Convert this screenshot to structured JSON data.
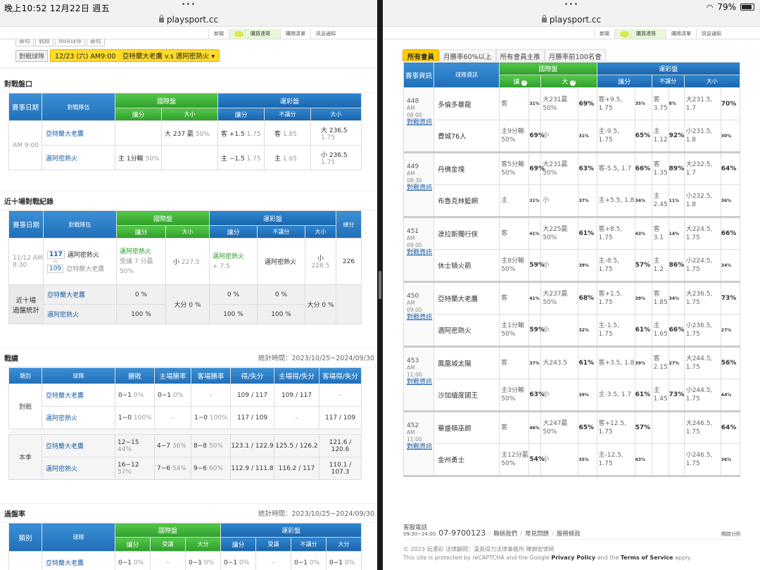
{
  "status_left": {
    "time": "晚上10:52",
    "date": "12月22日 週五"
  },
  "status_right": {
    "battery": "79%"
  },
  "url": "playsport.cc",
  "site_menu": [
    "新聞",
    "購買達哥",
    "購牌清單",
    "訊息通知"
  ],
  "site_menu_r": [
    "新聞",
    "購買達哥",
    "購牌清單",
    "訊息通知"
  ],
  "top_tabs": [
    "賽程",
    "戰績",
    "NBA球隊",
    "賽程"
  ],
  "match_select_label": "對戰球隊",
  "match_select_value": "12/23 (六) AM9:00　亞特蘭大老鷹 v.s 邁阿密熱火",
  "odds": {
    "title": "對戰盤口",
    "head": {
      "date": "賽事日期",
      "team": "對戰隊伍",
      "intl": "國際盤",
      "sport": "運彩盤",
      "spread": "讓分",
      "ou": "大小",
      "nospread": "不讓分"
    },
    "date": "AM 9:00",
    "teams": [
      "亞特蘭大老鷹",
      "邁阿密熱火"
    ],
    "r1": {
      "ou": "大 237 贏",
      "ou_p": "50%",
      "s_sp": "客 +1.5",
      "s_sp_o": "1.75",
      "s_ns": "客",
      "s_ns_o": "1.85",
      "s_ou": "大 236.5",
      "s_ou_o": "1.75"
    },
    "r2": {
      "sp": "主 1分輸",
      "sp_p": "50%",
      "s_sp": "主 −1.5",
      "s_sp_o": "1.75",
      "s_ns": "主",
      "s_ns_o": "1.65",
      "s_ou": "小 236.5",
      "s_ou_o": "1.75"
    }
  },
  "recent": {
    "title": "近十場對戰紀錄",
    "total": "總分",
    "date": "11/12 AM 8:30",
    "score_top": "117",
    "vs": "vs",
    "score_bot": "109",
    "team_top": "邁阿密熱火",
    "team_bot": "亞特蘭大老鷹",
    "sp_win": "邁阿密熱火",
    "sp_detail": "受讓 7 分贏",
    "sp_p": "50%",
    "ou": "小",
    "ou_v": "227.5",
    "s_sp_win": "邁阿密熱火",
    "s_sp_v": "+ 7.5",
    "s_ns": "邁阿密熱火",
    "s_ou": "小",
    "s_ou_v": "228.5",
    "total_v": "226",
    "stat_label": "近十場 過盤統計",
    "stat_teams": [
      "亞特蘭大老鷹",
      "邁阿密熱火"
    ],
    "stat_sp": [
      "0 %",
      "100 %"
    ],
    "stat_ou": "大分 0 %",
    "stat_s_sp": [
      "0 %",
      "100 %"
    ],
    "stat_s_ns": [
      "0 %",
      "100 %"
    ],
    "stat_s_ou": "大分 0 %"
  },
  "record": {
    "title": "戰績",
    "stat_period": "統計時間：2023/10/25~2024/09/30",
    "head": [
      "類別",
      "球隊",
      "勝敗",
      "主場勝率",
      "客場勝率",
      "得/失分",
      "主場得/失分",
      "客場得/失分"
    ],
    "g1": "對戰",
    "g2": "本季",
    "rows": [
      [
        "亞特蘭大老鷹",
        "0−1",
        "0%",
        "0−1",
        "0%",
        "–",
        "",
        "109 / 117",
        "109 / 117",
        "–"
      ],
      [
        "邁阿密熱火",
        "1−0",
        "100%",
        "–",
        "",
        "1−0",
        "100%",
        "117 / 109",
        "–",
        "117 / 109"
      ],
      [
        "亞特蘭大老鷹",
        "12−15",
        "44%",
        "4−7",
        "36%",
        "8−8",
        "50%",
        "123.1 / 122.9",
        "125.5 / 126.2",
        "121.6 / 120.6"
      ],
      [
        "邁阿密熱火",
        "16−12",
        "57%",
        "7−6",
        "54%",
        "9−6",
        "60%",
        "112.9 / 111.8",
        "116.2 / 117",
        "110.1 / 107.3"
      ]
    ]
  },
  "cover": {
    "title": "過盤率",
    "stat_period": "統計時間：2023/10/25~2024/09/30",
    "head": {
      "cat": "類別",
      "team": "球隊",
      "intl": "國際盤",
      "sport": "運彩盤",
      "spread": "讓分",
      "take": "受讓",
      "ou": "大分",
      "nospread": "不讓分"
    },
    "g1": "對戰",
    "row": [
      "亞特蘭大老鷹",
      "0−1",
      "0%",
      "–",
      "0−1",
      "0%",
      "0−1",
      "0%",
      "–",
      "0−1",
      "0%",
      "0−1",
      "0%"
    ]
  },
  "right": {
    "tabs": [
      "所有會員",
      "月勝率60%以上",
      "所有會員主推",
      "月勝率前100名會"
    ],
    "head": {
      "info": "賽事資訊",
      "team": "球隊資訊",
      "intl": "國際盤",
      "sport": "運彩盤",
      "spread": "讓",
      "ou": "大",
      "s_spread": "讓分",
      "s_ns": "不讓分",
      "s_ou": "大小"
    },
    "info_link": "對戰資訊",
    "games": [
      {
        "no": "448",
        "time": "AM 08:00",
        "a": {
          "team": "多倫多暴龍",
          "sp": "客",
          "sp_p": "31%",
          "ou": "大231贏 50%",
          "ou_p": "69%",
          "s_sp": "客+9.5, 1.75",
          "s_sp_p": "35%",
          "s_ns": "客 3.75",
          "s_ns_p": "8%",
          "s_ou": "大231.5, 1.7",
          "s_ou_p": "70%"
        },
        "b": {
          "team": "費城76人",
          "sp": "主9分輸 50%",
          "sp_p": "69%",
          "ou": "小",
          "ou_p": "31%",
          "s_sp": "主-9.5, 1.75",
          "s_sp_p": "65%",
          "s_ns": "主 1.12",
          "s_ns_p": "92%",
          "s_ou": "小231.5, 1.8",
          "s_ou_p": "30%"
        }
      },
      {
        "no": "449",
        "time": "AM 08:30",
        "a": {
          "team": "丹佛金塊",
          "sp": "客5分輸 50%",
          "sp_p": "69%",
          "ou": "大231贏 50%",
          "ou_p": "63%",
          "s_sp": "客-5.5, 1.7",
          "s_sp_p": "66%",
          "s_ns": "客 1.35",
          "s_ns_p": "89%",
          "s_ou": "大232.5, 1.7",
          "s_ou_p": "64%"
        },
        "b": {
          "team": "布魯克林籃網",
          "sp": "主",
          "sp_p": "31%",
          "ou": "小",
          "ou_p": "37%",
          "s_sp": "主+5.5, 1.8",
          "s_sp_p": "34%",
          "s_ns": "主 2.45",
          "s_ns_p": "11%",
          "s_ou": "小232.5, 1.8",
          "s_ou_p": "36%"
        }
      },
      {
        "no": "451",
        "time": "AM 09:00",
        "a": {
          "team": "達拉斯獨行俠",
          "sp": "客",
          "sp_p": "41%",
          "ou": "大225贏 50%",
          "ou_p": "61%",
          "s_sp": "客+8.5, 1.75",
          "s_sp_p": "43%",
          "s_ns": "客3.1",
          "s_ns_p": "14%",
          "s_ou": "大224.5, 1.75",
          "s_ou_p": "66%"
        },
        "b": {
          "team": "休士頓火箭",
          "sp": "主8分輸 50%",
          "sp_p": "59%",
          "ou": "小",
          "ou_p": "39%",
          "s_sp": "主-8.5, 1.75",
          "s_sp_p": "57%",
          "s_ns": "主1.2",
          "s_ns_p": "86%",
          "s_ou": "小224.5, 1.75",
          "s_ou_p": "34%"
        }
      },
      {
        "no": "450",
        "time": "AM 09:00",
        "a": {
          "team": "亞特蘭大老鷹",
          "sp": "客",
          "sp_p": "41%",
          "ou": "大237贏 50%",
          "ou_p": "68%",
          "s_sp": "客+1.5, 1.75",
          "s_sp_p": "39%",
          "s_ns": "客 1.85",
          "s_ns_p": "34%",
          "s_ou": "大236.5, 1.75",
          "s_ou_p": "73%"
        },
        "b": {
          "team": "邁阿密熱火",
          "sp": "主1分輸 50%",
          "sp_p": "59%",
          "ou": "小",
          "ou_p": "32%",
          "s_sp": "主-1.5, 1.75",
          "s_sp_p": "61%",
          "s_ns": "主 1.65",
          "s_ns_p": "66%",
          "s_ou": "小236.5, 1.75",
          "s_ou_p": "27%"
        }
      },
      {
        "no": "453",
        "time": "AM 11:00",
        "a": {
          "team": "鳳凰城太陽",
          "sp": "客",
          "sp_p": "37%",
          "ou": "大243.5",
          "ou_p": "61%",
          "s_sp": "客+3.5, 1.8",
          "s_sp_p": "39%",
          "s_ns": "客 2.15",
          "s_ns_p": "27%",
          "s_ou": "大244.5, 1.75",
          "s_ou_p": "56%"
        },
        "b": {
          "team": "沙加緬度國王",
          "sp": "主3分輸 50%",
          "sp_p": "63%",
          "ou": "小",
          "ou_p": "39%",
          "s_sp": "主-3.5, 1.7",
          "s_sp_p": "61%",
          "s_ns": "主 1.45",
          "s_ns_p": "73%",
          "s_ou": "小244.5, 1.75",
          "s_ou_p": "44%"
        }
      },
      {
        "no": "452",
        "time": "AM 11:00",
        "a": {
          "team": "華盛頓巫師",
          "sp": "客",
          "sp_p": "46%",
          "ou": "大247贏 50%",
          "ou_p": "65%",
          "s_sp": "客+12.5, 1.75",
          "s_sp_p": "57%",
          "s_ns": "",
          "s_ns_p": "",
          "s_ou": "大246.5, 1.75",
          "s_ou_p": "64%"
        },
        "b": {
          "team": "金州勇士",
          "sp": "主12分贏 50%",
          "sp_p": "54%",
          "ou": "小",
          "ou_p": "35%",
          "s_sp": "主-12.5, 1.75",
          "s_sp_p": "43%",
          "s_ns": "",
          "s_ns_p": "",
          "s_ou": "小246.5, 1.75",
          "s_ou_p": "36%"
        }
      }
    ],
    "footer": {
      "phone_label": "客服電話",
      "phone": "07-9700123",
      "hours": "09:30~24:00",
      "links": [
        "聯絡我們",
        "常見問題",
        "服務條款"
      ],
      "right": "開啟分析",
      "copy": "© 2023 玩運彩 法律顧問：漢英得力法律事務所 陳錦宏律師",
      "recaptcha_pre": "This site is protected by reCAPTCHA and the Google ",
      "pp": "Privacy Policy",
      "and": " and the ",
      "tos": "Terms of Service",
      "apply": " apply."
    }
  }
}
